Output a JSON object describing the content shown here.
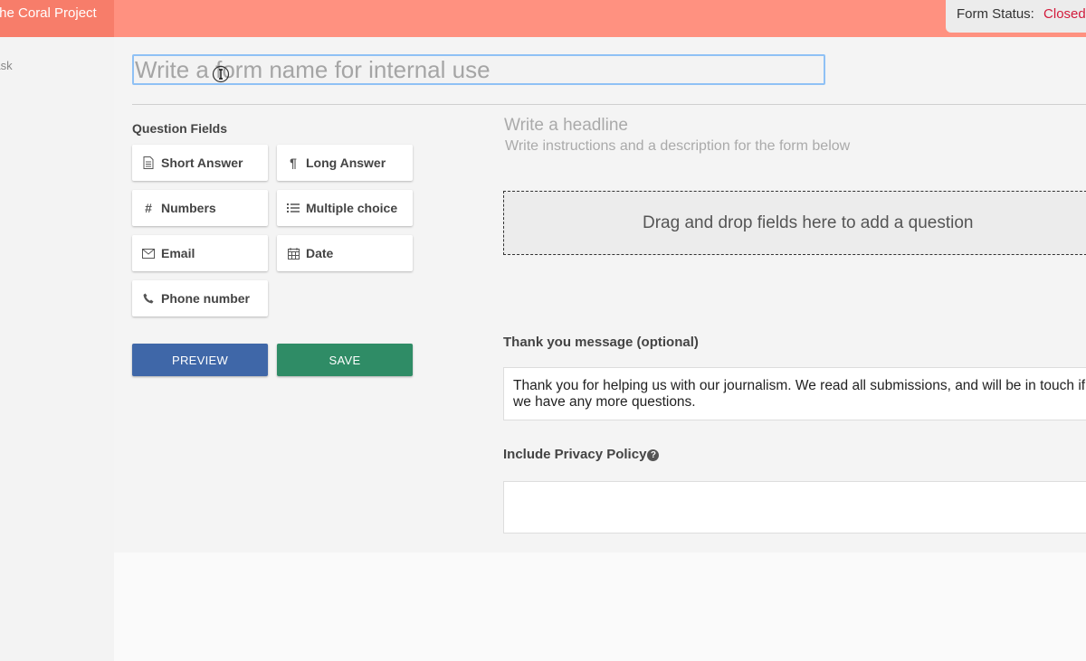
{
  "header": {
    "brand": "The Coral Project",
    "status_label": "Form Status:",
    "status_value": "Closed"
  },
  "sidebar": {
    "items": [
      {
        "label": "Ask"
      }
    ]
  },
  "form": {
    "name_placeholder": "Write a form name for internal use"
  },
  "question_fields": {
    "title": "Question Fields",
    "items": [
      {
        "label": "Short Answer",
        "icon": "document-icon"
      },
      {
        "label": "Long Answer",
        "icon": "paragraph-icon"
      },
      {
        "label": "Numbers",
        "icon": "hash-icon"
      },
      {
        "label": "Multiple choice",
        "icon": "list-icon"
      },
      {
        "label": "Email",
        "icon": "envelope-icon"
      },
      {
        "label": "Date",
        "icon": "calendar-icon"
      },
      {
        "label": "Phone number",
        "icon": "phone-icon"
      }
    ]
  },
  "actions": {
    "preview": "PREVIEW",
    "save": "SAVE"
  },
  "colors": {
    "topbar": "#ff9180",
    "brand_bg": "#f77d6a",
    "preview": "#3f67a8",
    "save": "#2f8c66",
    "status_closed": "#d21a3b"
  },
  "editor": {
    "headline_placeholder": "Write a headline",
    "instructions_placeholder": "Write instructions and a description for the form below",
    "dropzone_text": "Drag and drop fields here to add a question",
    "thanks_label": "Thank you message (optional)",
    "thanks_text": "Thank you for helping us with our journalism. We read all submissions, and will be in touch if we have any more questions.",
    "privacy_label": "Include Privacy Policy"
  }
}
